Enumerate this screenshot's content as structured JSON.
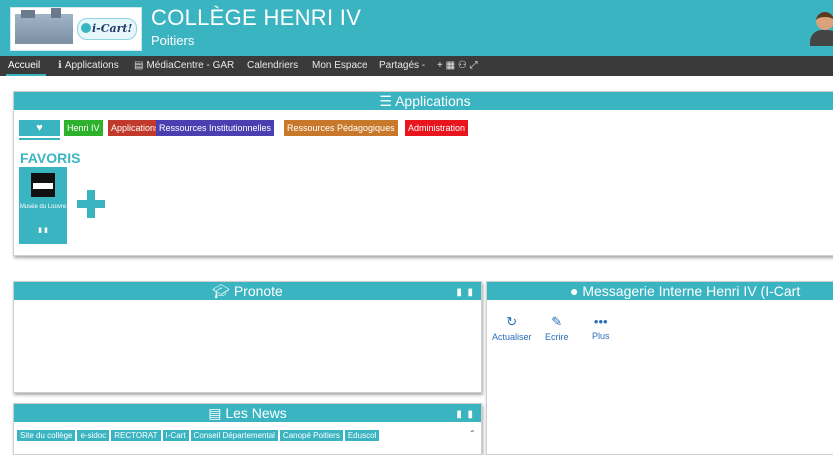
{
  "header": {
    "title": "COLLÈGE HENRI IV",
    "subtitle": "Poitiers",
    "logo_text": "i-Cart!"
  },
  "nav": {
    "items": [
      {
        "label": "Accueil",
        "icon": ""
      },
      {
        "label": "Applications",
        "icon": "info-icon"
      },
      {
        "label": "MédiaCentre - GAR",
        "icon": "film-icon"
      },
      {
        "label": "Calendriers",
        "icon": ""
      },
      {
        "label": "Mon Espace",
        "icon": ""
      },
      {
        "label": "Partagés -",
        "icon": ""
      }
    ],
    "tools": "+ ▦ ⚇ ⤢"
  },
  "applications": {
    "heading": "Applications",
    "heading_icon": "menu-icon",
    "tabs": [
      {
        "label": "♥",
        "color": "#3bb4c1"
      },
      {
        "label": "Henri IV",
        "color": "#2eb22e"
      },
      {
        "label": "Applications",
        "color": "#c0392b"
      },
      {
        "label": "Ressources Institutionnelles",
        "color": "#4a3fb0"
      },
      {
        "label": "Ressources Pédagogiques",
        "color": "#c8782a"
      },
      {
        "label": "Administration",
        "color": "#e8141e"
      }
    ],
    "favoris_label": "FAVORIS",
    "tiles": [
      {
        "label": "Musée du Louvre"
      }
    ]
  },
  "pronote": {
    "heading": "Pronote",
    "heading_icon": "graduation-cap-icon"
  },
  "news": {
    "heading": "Les News",
    "heading_icon": "newspaper-icon",
    "tabs": [
      "Site du collège",
      "e-sidoc",
      "RECTORAT",
      "I-Cart",
      "Conseil Départemental",
      "Canopé Poitiers",
      "Eduscol"
    ]
  },
  "messagerie": {
    "heading": "Messagerie Interne Henri IV (I-Cart",
    "heading_icon": "comments-icon",
    "actions": [
      {
        "label": "Actualiser",
        "icon": "refresh-icon"
      },
      {
        "label": "Ecrire",
        "icon": "edit-icon"
      },
      {
        "label": "Plus",
        "icon": "more-icon"
      }
    ]
  },
  "colors": {
    "accent": "#3bb4c1",
    "nav_bg": "#3a3a3a",
    "action_blue": "#2a6ebb"
  }
}
